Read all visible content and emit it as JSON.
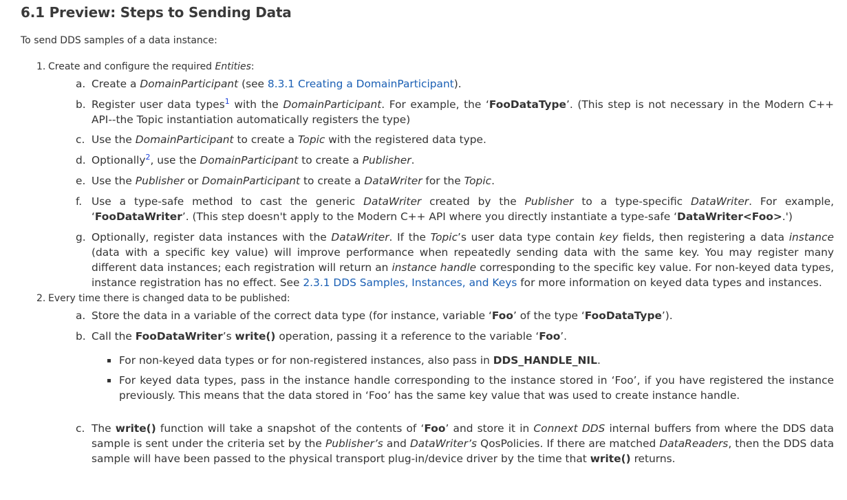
{
  "heading": "6.1 Preview: Steps to Sending Data",
  "intro": "To send DDS samples of a data instance:",
  "step1": {
    "num": "1.",
    "pre": "Create and configure the required ",
    "em": "Entities",
    "post": ":",
    "a": {
      "letter": "a.",
      "t1": "Create a ",
      "em1": "DomainParticipant",
      "t2": " (see ",
      "link": "8.3.1 Creating a DomainParticipant",
      "t3": ")."
    },
    "b": {
      "letter": "b.",
      "t1": "Register user data types",
      "sup": "1",
      "t2": " with the ",
      "em1": "DomainParticipant",
      "t3": ". For example, the ",
      "q1": "‘",
      "bold1": "FooDataType",
      "t4": "’. (This step is not necessary in the Modern C++ API--the Topic instantiation automatically registers the type)"
    },
    "c": {
      "letter": "c.",
      "t1": "Use the ",
      "em1": "DomainParticipant",
      "t2": " to create a ",
      "em2": "Topic",
      "t3": " with the registered data type."
    },
    "d": {
      "letter": "d.",
      "t1": "Optionally",
      "sup": "2",
      "t2": ", use the ",
      "em1": "DomainParticipant",
      "t3": " to create a ",
      "em2": "Publisher",
      "t4": "."
    },
    "e": {
      "letter": "e.",
      "t1": "Use the ",
      "em1": "Publisher",
      "t2": " or ",
      "em2": "DomainParticipant",
      "t3": " to create a ",
      "em3": "DataWriter",
      "t4": " for the ",
      "em4": "Topic",
      "t5": "."
    },
    "f": {
      "letter": "f.",
      "t1": "Use a type-safe method to cast the generic ",
      "em1": "DataWriter",
      "t2": " created by the ",
      "em2": "Publisher",
      "t3": " to a type-specific ",
      "em3": "DataWriter",
      "t4": ". For example, ‘",
      "bold1": "FooDataWriter",
      "t5": "’. (This step doesn't apply to the Modern C++ API where you directly instantiate a type-safe ‘",
      "bold2": "DataWriter<Foo>",
      "t6": ".')"
    },
    "g": {
      "letter": "g.",
      "t1": "Optionally, register data instances with the ",
      "em1": "DataWriter",
      "t2": ". If the ",
      "em2": "Topic",
      "t3": "’s user data type contain ",
      "em3": "key",
      "t4": " fields, then registering a data ",
      "em4": "instance",
      "t5": " (data with a specific key value) will improve performance when repeatedly sending data with the same key. You may register many different data instances; each registration will return an ",
      "em5": "instance handle",
      "t6": " corresponding to the specific key value. For non-keyed data types, instance registration has no effect. See ",
      "link": "2.3.1 DDS Samples, Instances, and Keys",
      "t7": " for more information on keyed data types and instances."
    }
  },
  "step2": {
    "num": "2.",
    "text": "Every time there is changed data to be published:",
    "a": {
      "letter": "a.",
      "t1": "Store the data in a variable of the correct data type (for instance, variable ‘",
      "bold1": "Foo",
      "t2": "’ of the type ‘",
      "bold2": "FooDataType",
      "t3": "’)."
    },
    "b": {
      "letter": "b.",
      "t1": "Call the ",
      "bold1": "FooDataWriter",
      "t2": "’s ",
      "bold2": "write()",
      "t3": " operation, passing it a reference to the variable ‘",
      "bold3": "Foo",
      "t4": "’."
    },
    "bullets": [
      {
        "t1": "For non-keyed data types or for non-registered instances, also pass in ",
        "bold1": "DDS_HANDLE_NIL",
        "t2": "."
      },
      {
        "t1": "For keyed data types, pass in the instance handle corresponding to the instance stored in ‘Foo’, if you have registered the instance previously. This means that the data stored in ‘Foo’ has the same key value that was used to create instance handle.",
        "bold1": "",
        "t2": ""
      }
    ],
    "c": {
      "letter": "c.",
      "t1": "The ",
      "bold1": "write()",
      "t2": " function will take a snapshot of the contents of ‘",
      "bold2": "Foo",
      "t3": "’ and store it in ",
      "em1": "Connext DDS",
      "t4": " internal buffers from where the DDS data sample is sent under the criteria set by the ",
      "em2": "Publisher’s",
      "t5": " and ",
      "em3": "DataWriter’s",
      "t6": " QosPolicies. If there are matched ",
      "em4": "DataReaders",
      "t7": ", then the DDS data sample will have been passed to the physical transport plug-in/device driver by the time that ",
      "bold3": "write()",
      "t8": " returns."
    }
  }
}
